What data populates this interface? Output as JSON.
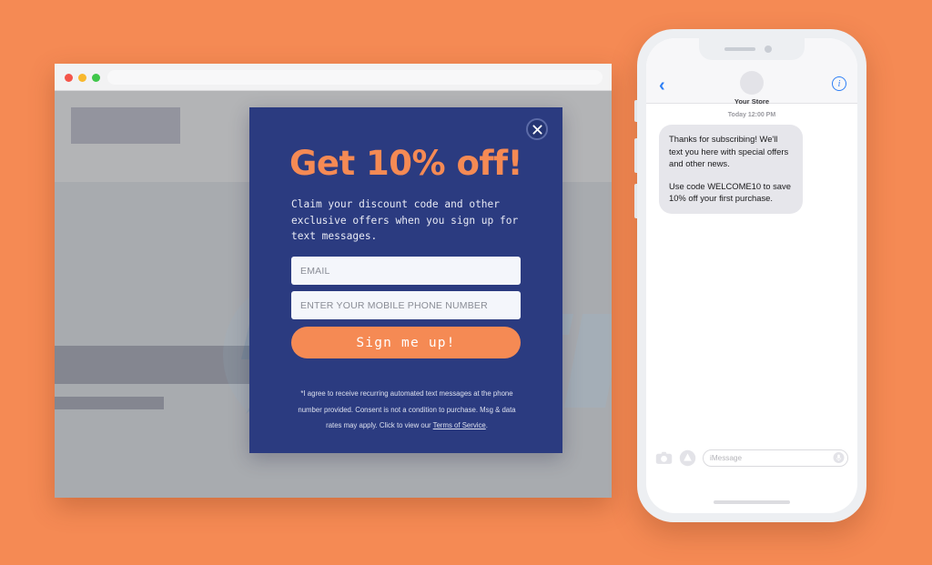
{
  "colors": {
    "background_orange": "#F58A54",
    "modal_navy": "#2B3B80",
    "accent_orange": "#F58A54",
    "imessage_blue": "#2E7FF5",
    "bubble_gray": "#E6E6EB"
  },
  "browser": {
    "traffic_lights": [
      "close",
      "minimize",
      "zoom"
    ],
    "url_value": "",
    "url_placeholder": ""
  },
  "modal": {
    "close_label": "Close",
    "title": "Get 10% off!",
    "subtitle": "Claim your discount code and other exclusive offers when you sign up for text messages.",
    "email_placeholder": "EMAIL",
    "email_value": "",
    "phone_placeholder": "ENTER YOUR MOBILE PHONE NUMBER",
    "phone_value": "",
    "submit_label": "Sign me up!",
    "fineprint_lead": "*I agree to receive recurring automated text messages at the phone number provided. Consent is not a condition to purchase. Msg & data rates may apply. Click to view our ",
    "fineprint_link": "Terms of Service",
    "fineprint_tail": "."
  },
  "phone": {
    "back_glyph": "‹",
    "info_glyph": "i",
    "contact_name": "Your Store",
    "timestamp": "Today 12:00 PM",
    "messages": [
      {
        "sender": "store",
        "paragraphs": [
          "Thanks for subscribing! We'll text you here with special offers and other news.",
          "Use code WELCOME10 to save 10% off your first purchase."
        ]
      }
    ],
    "input_placeholder": "iMessage",
    "input_value": ""
  }
}
